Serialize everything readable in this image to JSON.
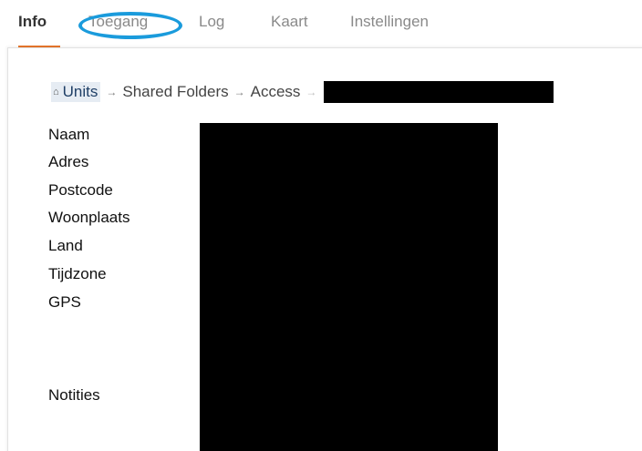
{
  "tabs": [
    {
      "label": "Info",
      "active": true
    },
    {
      "label": "Toegang",
      "active": false,
      "highlighted": true
    },
    {
      "label": "Log",
      "active": false
    },
    {
      "label": "Kaart",
      "active": false
    },
    {
      "label": "Instellingen",
      "active": false
    }
  ],
  "breadcrumb": {
    "home_icon": "home-icon",
    "items": [
      "Units",
      "Shared Folders",
      "Access"
    ],
    "separator": "→",
    "last_item_redacted": true
  },
  "fields": {
    "labels": [
      "Naam",
      "Adres",
      "Postcode",
      "Woonplaats",
      "Land",
      "Tijdzone",
      "GPS",
      "Notities"
    ],
    "values_redacted": true
  },
  "colors": {
    "active_tab_underline": "#e8762c",
    "highlight_circle": "#1a9bdc",
    "breadcrumb_home_bg": "#e6ecf3",
    "redaction": "#000000"
  }
}
